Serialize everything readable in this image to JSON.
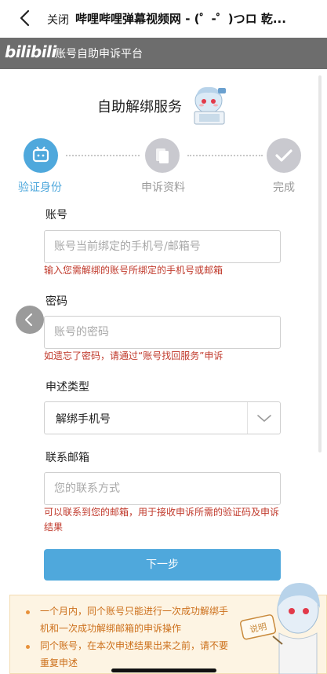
{
  "topbar": {
    "close_label": "关闭",
    "title": "哔哩哔哩弹幕视频网 - (゜-゜)つロ 乾..."
  },
  "header": {
    "logo_text": "bilibili",
    "title": "账号自助申诉平台"
  },
  "service_title": "自助解绑服务",
  "steps": [
    {
      "label": "验证身份",
      "active": true
    },
    {
      "label": "申诉资料",
      "active": false
    },
    {
      "label": "完成",
      "active": false
    }
  ],
  "form": {
    "account": {
      "label": "账号",
      "placeholder": "账号当前绑定的手机号/邮箱号",
      "value": "",
      "hint": "输入您需解绑的账号所绑定的手机号或邮箱"
    },
    "password": {
      "label": "密码",
      "placeholder": "账号的密码",
      "value": "",
      "hint": "如遗忘了密码，请通过“账号找回服务”申诉"
    },
    "appeal_type": {
      "label": "申述类型",
      "selected": "解绑手机号"
    },
    "email": {
      "label": "联系邮箱",
      "placeholder": "您的联系方式",
      "value": "",
      "hint_line1": "可以联系到您的邮箱，用于接收申诉所需的验证码及申诉",
      "hint_line2": "结果"
    },
    "next_label": "下一步"
  },
  "notice": {
    "item1_line1": "一个月内，同个账号只能进行一次成功解绑手",
    "item1_line2": "机和一次成功解绑邮箱的申诉操作",
    "item2_line1": "同个账号，在本次申述结果出来之前，请不要",
    "item2_line2": "重复申述"
  },
  "mascot_sign": "说明",
  "colors": {
    "accent": "#4fa8dc",
    "header_bg": "#6d6d6d",
    "hint_red": "#c0392b",
    "notice_text": "#cc6f1a",
    "inactive_step": "#c9c9cf"
  }
}
